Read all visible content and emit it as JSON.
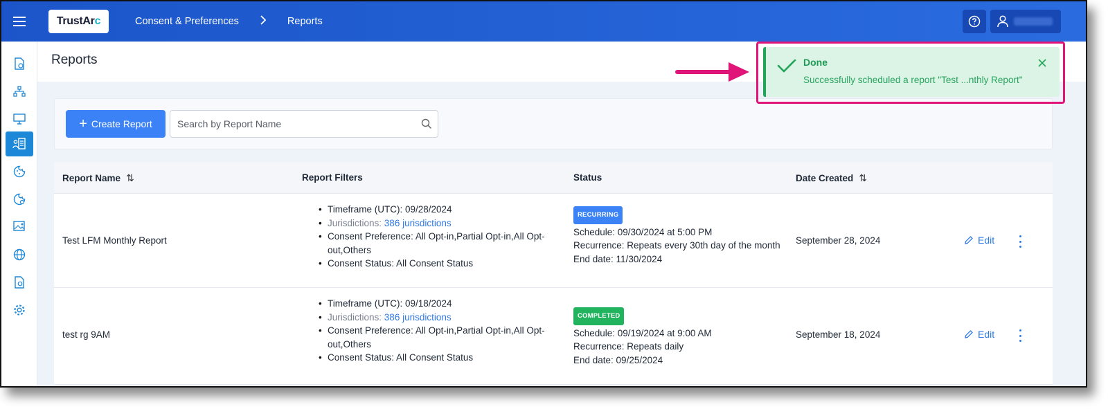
{
  "header": {
    "logo_text_main": "TrustAr",
    "logo_text_accent": "c",
    "breadcrumb": [
      "Consent & Preferences",
      "Reports"
    ],
    "breadcrumb_separator": ">"
  },
  "sidebar": {
    "items": [
      {
        "icon": "document-clock-icon",
        "active": false
      },
      {
        "icon": "hierarchy-icon",
        "active": false
      },
      {
        "icon": "monitor-icon",
        "active": false
      },
      {
        "icon": "reports-icon",
        "active": true
      },
      {
        "icon": "cookie-icon",
        "active": false
      },
      {
        "icon": "cookie-settings-icon",
        "active": false
      },
      {
        "icon": "image-settings-icon",
        "active": false
      },
      {
        "icon": "globe-icon",
        "active": false
      },
      {
        "icon": "document-gear-icon",
        "active": false
      },
      {
        "icon": "gear-icon",
        "active": false
      }
    ]
  },
  "page": {
    "title": "Reports"
  },
  "toolbar": {
    "create_label": "Create Report",
    "search_placeholder": "Search by Report Name"
  },
  "table": {
    "columns": [
      "Report Name",
      "Report Filters",
      "Status",
      "Date Created"
    ],
    "sort_symbol": "⇅",
    "edit_label": "Edit",
    "rows": [
      {
        "name": "Test LFM Monthly Report",
        "timeframe": "Timeframe (UTC): 09/28/2024",
        "jurisdictions_label": "Jurisdictions:",
        "jurisdictions_link": "386 jurisdictions",
        "consent_preference": "Consent Preference: All Opt-in,Partial Opt-in,All Opt-out,Others",
        "consent_status": "Consent Status: All Consent Status",
        "badge": "RECURRING",
        "schedule": "Schedule: 09/30/2024 at 5:00 PM",
        "recurrence": "Recurrence: Repeats every 30th day of the month",
        "end_date": "End date: 11/30/2024",
        "date_created": "September 28, 2024"
      },
      {
        "name": "test rg 9AM",
        "timeframe": "Timeframe (UTC): 09/18/2024",
        "jurisdictions_label": "Jurisdictions:",
        "jurisdictions_link": "386 jurisdictions",
        "consent_preference": "Consent Preference: All Opt-in,Partial Opt-in,All Opt-out,Others",
        "consent_status": "Consent Status: All Consent Status",
        "badge": "COMPLETED",
        "schedule": "Schedule: 09/19/2024 at 9:00 AM",
        "recurrence": "Recurrence: Repeats daily",
        "end_date": "End date: 09/25/2024",
        "date_created": "September 18, 2024"
      }
    ]
  },
  "toast": {
    "title": "Done",
    "message": "Successfully scheduled a report \"Test ...nthly Report\""
  },
  "colors": {
    "brand_blue": "#1b55c9",
    "accent_blue": "#3b82f6",
    "success_green": "#22a559",
    "highlight_pink": "#e0157a"
  }
}
